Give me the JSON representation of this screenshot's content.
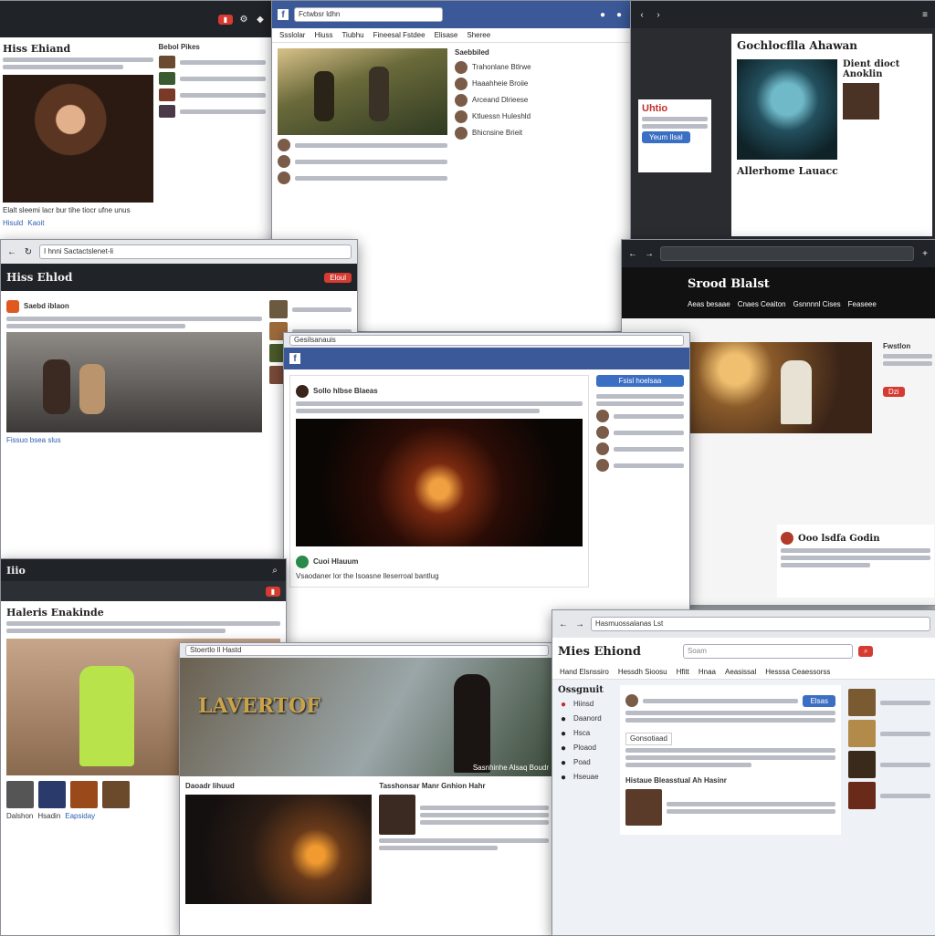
{
  "w1": {
    "title": "Hiss Ehiand",
    "caption": "Elalt sleemi lacr bur tihe tiocr ufne unus",
    "links": [
      "Hisuld",
      "Kaoit"
    ],
    "side_title": "Bebol Pikes"
  },
  "w2": {
    "search": "Fctwbsr ldhn",
    "tabs": [
      "Ssslolar",
      "Hiuss",
      "Tiubhu",
      "Fineesal Fstdee",
      "Elisase",
      "Sheree"
    ],
    "feed_title": "Saebbiled",
    "rows": [
      "Trahonlane Btlrwe",
      "Haaahheie Broiie",
      "Arceand Dlrieese",
      "Ktluessn Huleshld",
      "Bhicnsine Brieit"
    ]
  },
  "w3": {
    "title": "Gochlocflla Ahawan",
    "subtitle": "Dient dioct Anoklin",
    "promo": "Uhtio",
    "promo_button": "Yeum Ilsal",
    "footer_title": "Allerhome Lauacc"
  },
  "w4": {
    "title": "Hiss Ehlod",
    "address": "I hnni Sactactslenet-li",
    "post_author": "Saebd iblaon",
    "button": "Eloul",
    "link": "Fissuo bsea slus"
  },
  "w5": {
    "title": "Srood Blalst",
    "tabs": [
      "Aeas besaae",
      "Cnaes Ceaiton",
      "Gsnnnnl Cises",
      "Feaseee"
    ],
    "side_title": "Fwstlon",
    "button": "Dzi",
    "card_title": "Ooo lsdfa Godin"
  },
  "w6": {
    "address": "Gesilsanauis",
    "post_title": "Sollo hlbse Blaeas",
    "button": "Fsisl hoelsaa",
    "comment_author": "Cuoi Hlauum",
    "comment": "Vsaodaner lor the Isoasne lleserroal bantlug"
  },
  "w7": {
    "title": "Iiio",
    "heading": "Haleris Enakinde",
    "badge": "Dalshon",
    "label": "Hsadin",
    "link": "Eapsiday"
  },
  "w8": {
    "address": "Stoertlo ll Hastd",
    "logo": "LAVERTOF",
    "banner_caption": "Sasnhinhe Alsaq Boudr",
    "card_title": "Daoadr lihuud",
    "section_title": "Tasshonsar Manr Gnhion Hahr"
  },
  "w9": {
    "address": "Hasmuossalanas Lst",
    "title": "Mies Ehiond",
    "search_placeholder": "Soam",
    "nav": [
      "Hand Elsnssiro",
      "Hessdh Sioosu",
      "Hfitt",
      "Hnaa",
      "Aeasissal",
      "Hesssa Ceaessorss"
    ],
    "side_title": "Ossgnuit",
    "side_items": [
      "Hiinsd",
      "Daanord",
      "Hsca",
      "Ploaod",
      "Poad",
      "Hseuae"
    ],
    "post_button": "Elsas",
    "reply_label": "Gonsotiaad",
    "section_title": "Histaue Bleasstual Ah Hasinr"
  },
  "colors": {
    "fb_blue": "#3b5998",
    "accent_red": "#d63b32",
    "dark_chrome": "#202327"
  }
}
